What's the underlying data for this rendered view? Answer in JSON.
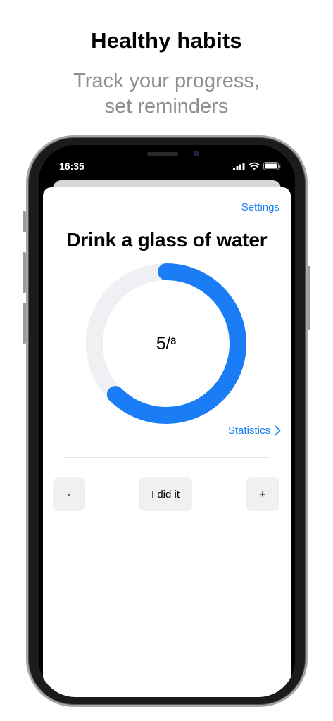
{
  "promo": {
    "headline": "Healthy habits",
    "subline_1": "Track your progress,",
    "subline_2": "set reminders"
  },
  "status_bar": {
    "time": "16:35",
    "icons": [
      "cellular-signal-icon",
      "wifi-icon",
      "battery-icon"
    ]
  },
  "habit": {
    "settings_label": "Settings",
    "title": "Drink a glass of water",
    "progress": {
      "done": 5,
      "goal": 8,
      "done_text": "5",
      "slash": "/",
      "goal_text": "8"
    },
    "statistics_label": "Statistics"
  },
  "actions": {
    "minus_label": "-",
    "did_it_label": "I did it",
    "plus_label": "+"
  },
  "colors": {
    "accent": "#1a7df5",
    "ring_track": "#efeff4",
    "button_bg": "#f0f0f2",
    "secondary_text": "#8e8e93"
  }
}
